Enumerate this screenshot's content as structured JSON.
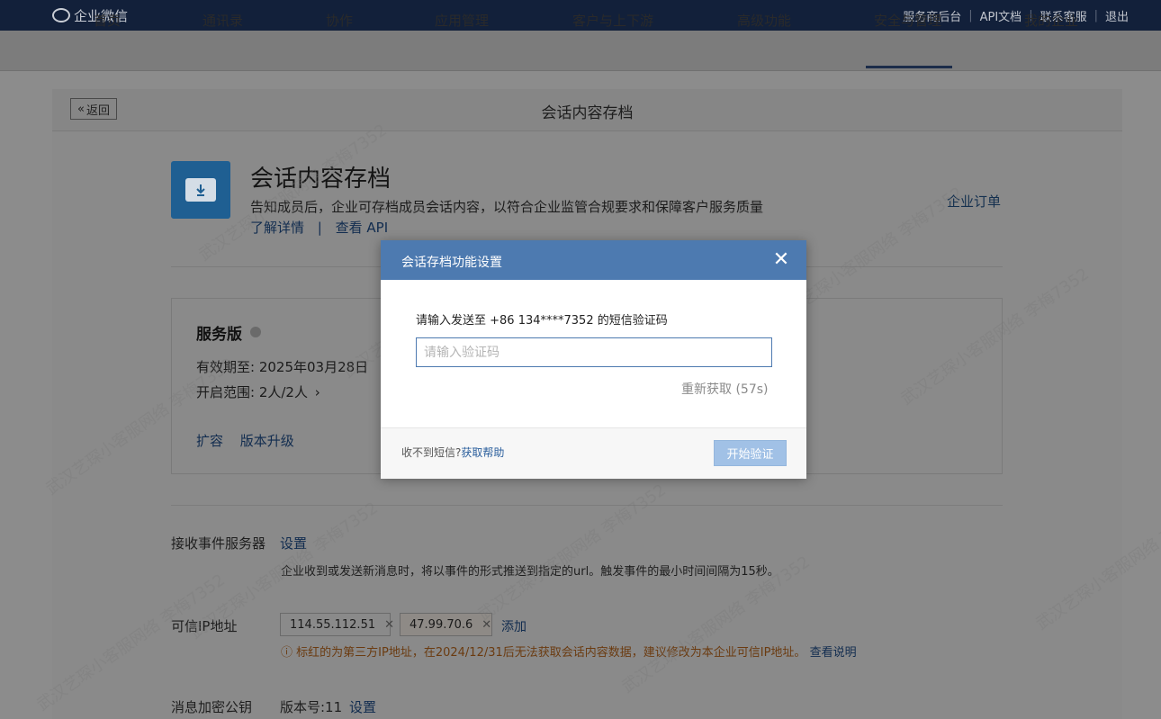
{
  "topbar": {
    "logo": "企业微信",
    "links": [
      "服务商后台",
      "API文档",
      "联系客服",
      "退出"
    ]
  },
  "nav": {
    "items": [
      "首页",
      "通讯录",
      "协作",
      "应用管理",
      "客户与上下游",
      "高级功能",
      "安全与管理",
      "我的企业"
    ],
    "active": "安全与管理"
  },
  "page": {
    "back_label": "返回",
    "header_title": "会话内容存档",
    "app_title": "会话内容存档",
    "app_desc": "告知成员后，企业可存档成员会话内容，以符合企业监管合规要求和保障客户服务质量",
    "learn_more": "了解详情",
    "link_sep": "|",
    "view_api": "查看 API",
    "order_link": "企业订单"
  },
  "service": {
    "title": "服务版",
    "valid_label": "有效期至: 2025年03月28日",
    "scope_label": "开启范围: 2人/2人",
    "expand": "扩容",
    "upgrade": "版本升级"
  },
  "settings": {
    "event_server_label": "接收事件服务器",
    "event_server_link": "设置",
    "event_server_desc": "企业收到或发送新消息时，将以事件的形式推送到指定的url。触发事件的最小时间间隔为15秒。",
    "trusted_ip_label": "可信IP地址",
    "ips": [
      "114.55.112.51",
      "47.99.70.6"
    ],
    "add_link": "添加",
    "warning": "标红的为第三方IP地址，在2024/12/31后无法获取会话内容数据，建议修改为本企业可信IP地址。",
    "warning_link": "查看说明",
    "pubkey_label": "消息加密公钥",
    "pubkey_version": "版本号:11",
    "pubkey_link": "设置"
  },
  "watermark": "武汉艺琛小客服网络 李梅7352",
  "modal": {
    "title": "会话存档功能设置",
    "close_icon": "close-icon",
    "prompt": "请输入发送至 +86 134****7352 的短信验证码",
    "input_placeholder": "请输入验证码",
    "resend": "重新获取 (57s)",
    "foot_text": "收不到短信?",
    "help_link": "获取帮助",
    "verify_button": "开始验证"
  },
  "colors": {
    "topbar": "#12203a",
    "modal_header": "#4d7ab0",
    "primary_disabled": "#a1c1e6"
  }
}
